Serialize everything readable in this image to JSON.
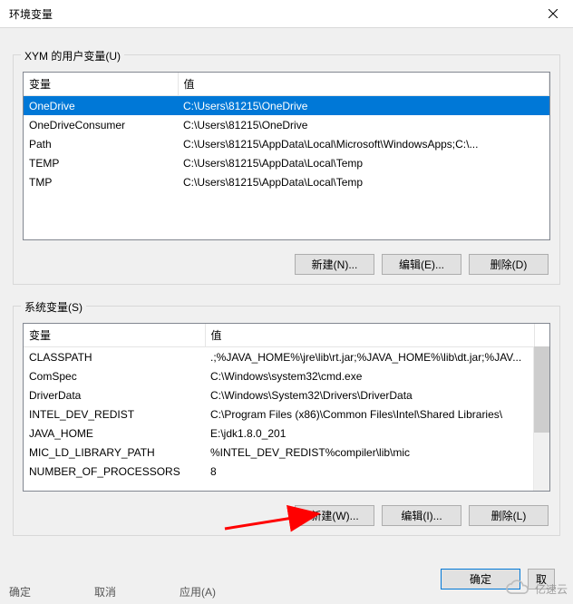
{
  "titlebar": {
    "title": "环境变量"
  },
  "user_group": {
    "label": "XYM 的用户变量(U)",
    "columns": {
      "var": "变量",
      "val": "值"
    },
    "rows": [
      {
        "var": "OneDrive",
        "val": "C:\\Users\\81215\\OneDrive"
      },
      {
        "var": "OneDriveConsumer",
        "val": "C:\\Users\\81215\\OneDrive"
      },
      {
        "var": "Path",
        "val": "C:\\Users\\81215\\AppData\\Local\\Microsoft\\WindowsApps;C:\\..."
      },
      {
        "var": "TEMP",
        "val": "C:\\Users\\81215\\AppData\\Local\\Temp"
      },
      {
        "var": "TMP",
        "val": "C:\\Users\\81215\\AppData\\Local\\Temp"
      }
    ],
    "buttons": {
      "new": "新建(N)...",
      "edit": "编辑(E)...",
      "delete": "删除(D)"
    }
  },
  "sys_group": {
    "label": "系统变量(S)",
    "columns": {
      "var": "变量",
      "val": "值"
    },
    "rows": [
      {
        "var": "CLASSPATH",
        "val": ".;%JAVA_HOME%\\jre\\lib\\rt.jar;%JAVA_HOME%\\lib\\dt.jar;%JAV..."
      },
      {
        "var": "ComSpec",
        "val": "C:\\Windows\\system32\\cmd.exe"
      },
      {
        "var": "DriverData",
        "val": "C:\\Windows\\System32\\Drivers\\DriverData"
      },
      {
        "var": "INTEL_DEV_REDIST",
        "val": "C:\\Program Files (x86)\\Common Files\\Intel\\Shared Libraries\\"
      },
      {
        "var": "JAVA_HOME",
        "val": "E:\\jdk1.8.0_201"
      },
      {
        "var": "MIC_LD_LIBRARY_PATH",
        "val": "%INTEL_DEV_REDIST%compiler\\lib\\mic"
      },
      {
        "var": "NUMBER_OF_PROCESSORS",
        "val": "8"
      }
    ],
    "buttons": {
      "new": "新建(W)...",
      "edit": "编辑(I)...",
      "delete": "删除(L)"
    }
  },
  "dialog_buttons": {
    "ok": "确定",
    "cancel": "取"
  },
  "bg_buttons": {
    "ok": "确定",
    "cancel": "取消",
    "apply": "应用(A)"
  },
  "watermark": "亿速云"
}
